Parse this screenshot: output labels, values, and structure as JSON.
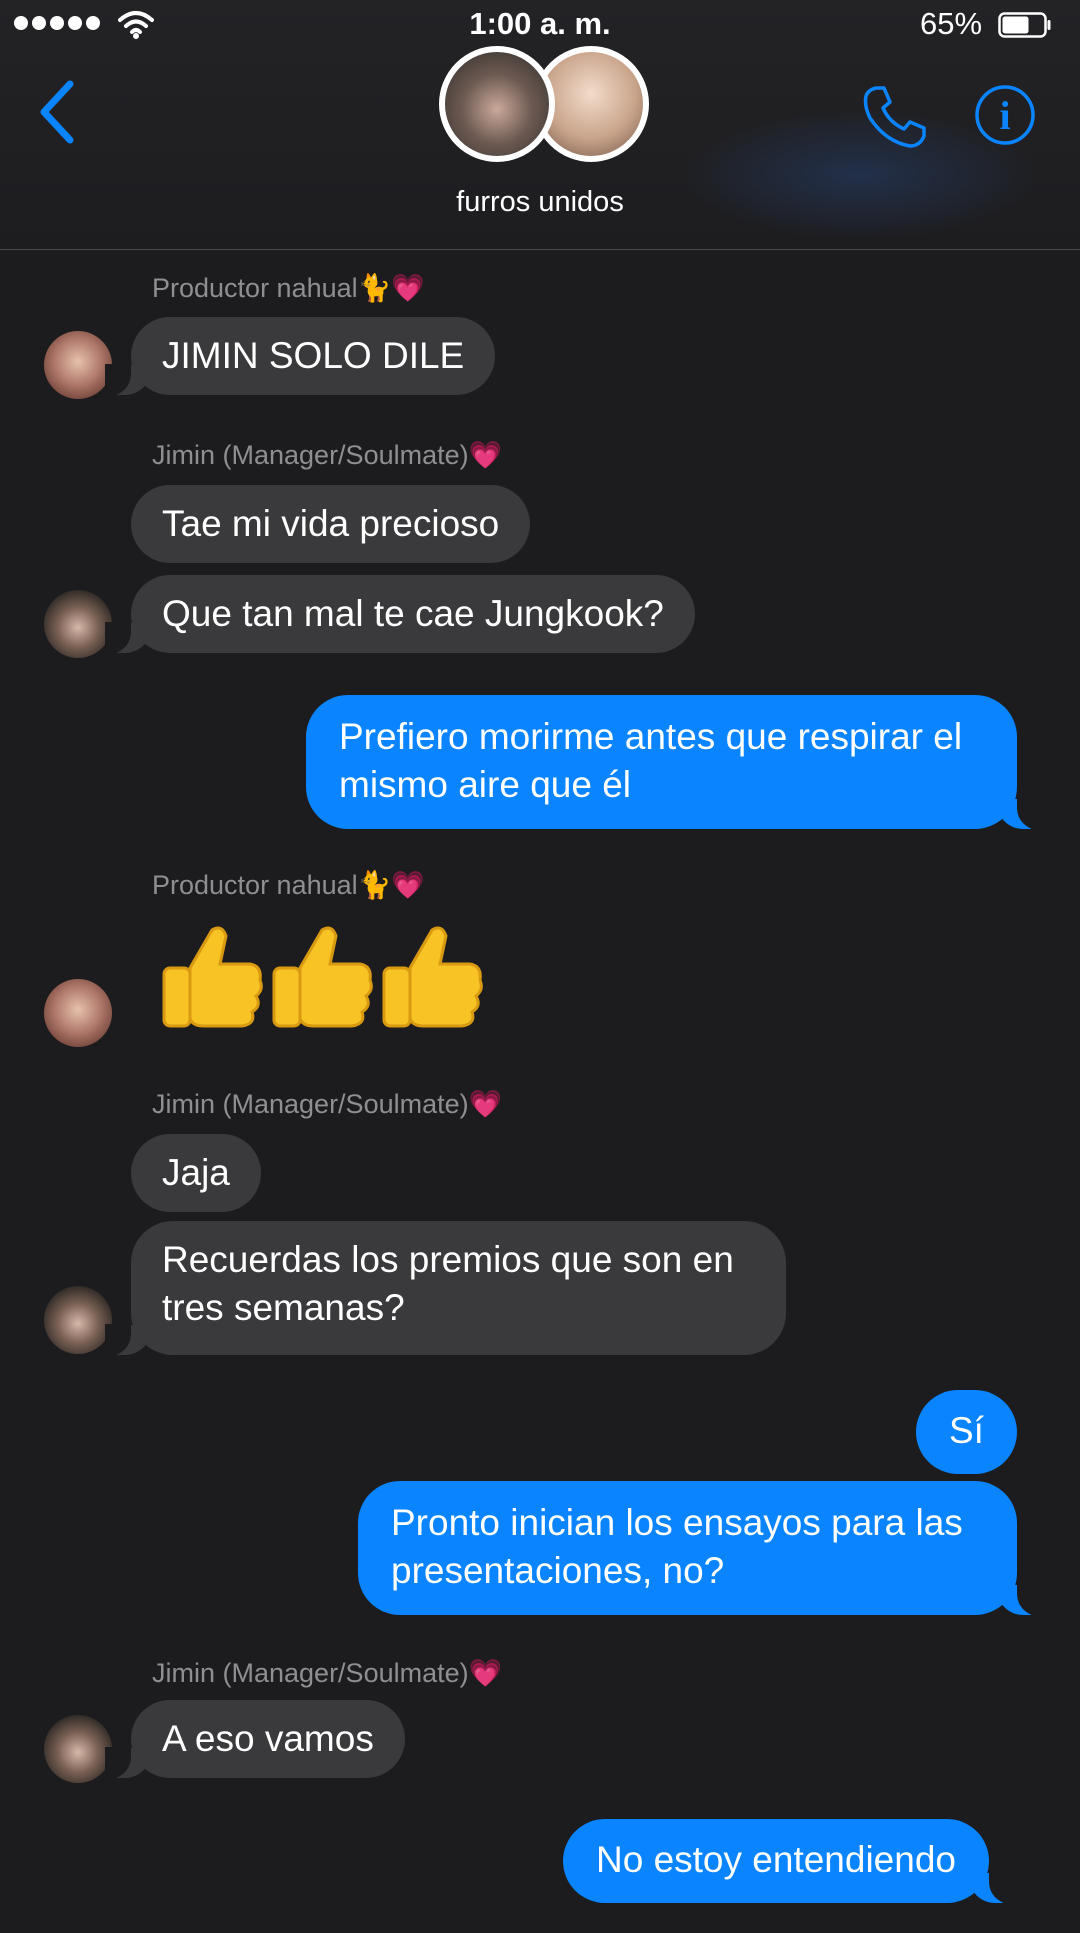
{
  "status_bar": {
    "time": "1:00 a. m.",
    "battery": "65%",
    "battery_level": 0.65
  },
  "nav": {
    "group_name": "furros unidos"
  },
  "messages": [
    {
      "sender": "Productor nahual🐈💗",
      "text": "JIMIN SOLO DILE"
    },
    {
      "sender": "Jimin (Manager/Soulmate)💗",
      "text": "Tae mi vida precioso"
    },
    {
      "text": "Que tan mal te cae Jungkook?"
    },
    {
      "text_lines": [
        "Prefiero morirme antes que respirar el",
        "mismo aire que él"
      ]
    },
    {
      "sender": "Productor nahual🐈💗",
      "emoji": "👍👍👍"
    },
    {
      "sender": "Jimin (Manager/Soulmate)💗",
      "text": "Jaja"
    },
    {
      "text_lines": [
        "Recuerdas los premios que son en",
        "tres semanas?"
      ]
    },
    {
      "text": "Sí"
    },
    {
      "text_lines": [
        "Pronto inician los ensayos para las",
        "presentaciones, no?"
      ]
    },
    {
      "sender": "Jimin (Manager/Soulmate)💗",
      "text": "A eso vamos"
    },
    {
      "text": "No estoy entendiendo"
    }
  ],
  "colors": {
    "background": "#1c1c1e",
    "incoming_bubble": "#3a3a3c",
    "outgoing_bubble": "#0a84ff",
    "accent": "#0a84ff",
    "sender_label": "#8e8e93"
  },
  "icons": {
    "back": "chevron-left-icon",
    "call": "phone-icon",
    "details": "info-icon",
    "signal": "signal-dots-icon",
    "wifi": "wifi-icon",
    "battery": "battery-icon"
  }
}
